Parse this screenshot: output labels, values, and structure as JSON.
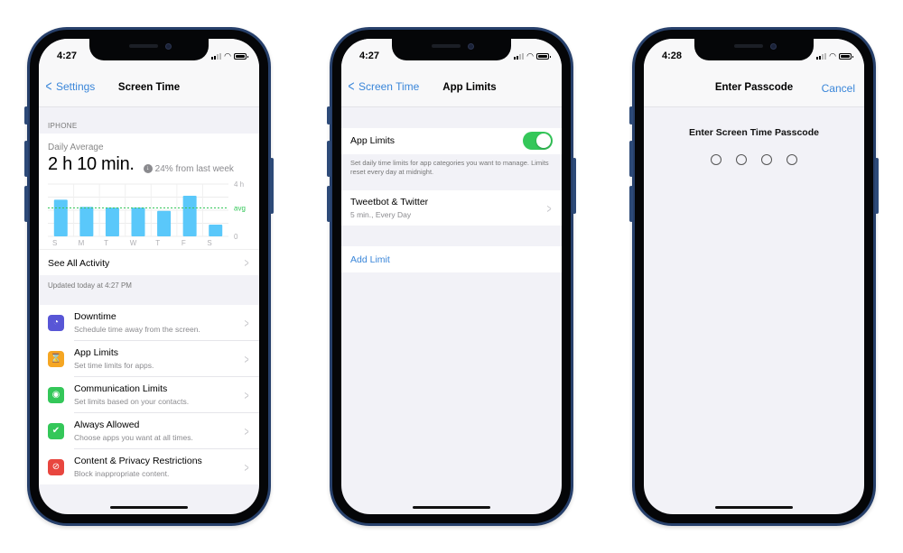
{
  "phones": [
    {
      "status": {
        "time": "4:27"
      },
      "nav": {
        "back_label": "Settings",
        "title": "Screen Time"
      },
      "section_header": "IPHONE",
      "daily": {
        "label": "Daily Average",
        "value": "2 h 10 min.",
        "delta": "24% from last week",
        "delta_icon": "arrow-down-circle-icon"
      },
      "see_all": "See All Activity",
      "updated": "Updated today at 4:27 PM",
      "items": [
        {
          "title": "Downtime",
          "subtitle": "Schedule time away from the screen.",
          "icon": "downtime-icon",
          "glyph": "◔",
          "color": "#5856d6"
        },
        {
          "title": "App Limits",
          "subtitle": "Set time limits for apps.",
          "icon": "hourglass-icon",
          "glyph": "⌛",
          "color": "#f5a623"
        },
        {
          "title": "Communication Limits",
          "subtitle": "Set limits based on your contacts.",
          "icon": "person-circle-icon",
          "glyph": "◉",
          "color": "#34c759"
        },
        {
          "title": "Always Allowed",
          "subtitle": "Choose apps you want at all times.",
          "icon": "checkmark-shield-icon",
          "glyph": "✔",
          "color": "#34c759"
        },
        {
          "title": "Content & Privacy Restrictions",
          "subtitle": "Block inappropriate content.",
          "icon": "prohibited-icon",
          "glyph": "⊘",
          "color": "#e8463f"
        }
      ]
    },
    {
      "status": {
        "time": "4:27"
      },
      "nav": {
        "back_label": "Screen Time",
        "title": "App Limits"
      },
      "toggle": {
        "label": "App Limits",
        "on": true
      },
      "description": "Set daily time limits for app categories you want to manage. Limits reset every day at midnight.",
      "limit": {
        "title": "Tweetbot & Twitter",
        "subtitle": "5 min., Every Day"
      },
      "add_limit": "Add Limit"
    },
    {
      "status": {
        "time": "4:28"
      },
      "nav": {
        "title": "Enter Passcode",
        "right_label": "Cancel"
      },
      "prompt": "Enter Screen Time Passcode",
      "passcode_length": 4,
      "digits_entered": 0
    }
  ],
  "chart_data": {
    "type": "bar",
    "categories": [
      "S",
      "M",
      "T",
      "W",
      "T",
      "F",
      "S"
    ],
    "values": [
      2.8,
      2.25,
      2.2,
      2.2,
      1.95,
      3.1,
      0.9
    ],
    "average": 2.17,
    "ylim": [
      0,
      4
    ],
    "y_tick_labels": [
      "4 h",
      "avg",
      "0"
    ],
    "units": "hours",
    "bar_color": "#5ac8fa",
    "avg_color": "#34c759"
  }
}
